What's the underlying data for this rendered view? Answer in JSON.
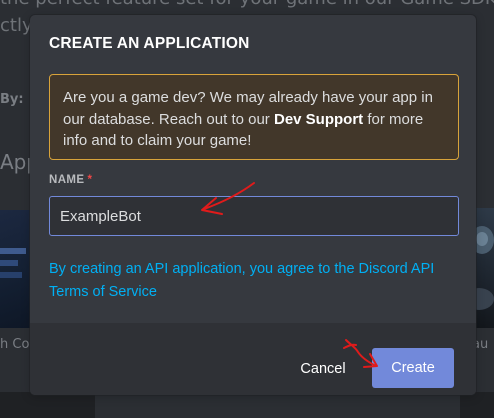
{
  "background": {
    "text_line_1": "the perfect feature set for your game in our Game SDK, and",
    "text_line_2": "ctly",
    "text_line_3": "By:",
    "text_line_4": "App",
    "text_line_5": "h Co",
    "text_line_6": "au"
  },
  "modal": {
    "title": "CREATE AN APPLICATION",
    "notice": {
      "text_before": "Are you a game dev? We may already have your app in our database. Reach out to our ",
      "link_text": "Dev Support",
      "text_after": " for more info and to claim your game!"
    },
    "name_field": {
      "label": "NAME",
      "required_marker": "*",
      "value": "ExampleBot"
    },
    "tos_text": "By creating an API application, you agree to the Discord API Terms of Service",
    "buttons": {
      "cancel": "Cancel",
      "create": "Create"
    }
  },
  "colors": {
    "accent": "#7289da",
    "link": "#00b0f4",
    "warning_border": "#d8a33a",
    "annotation": "#e01b1b"
  }
}
